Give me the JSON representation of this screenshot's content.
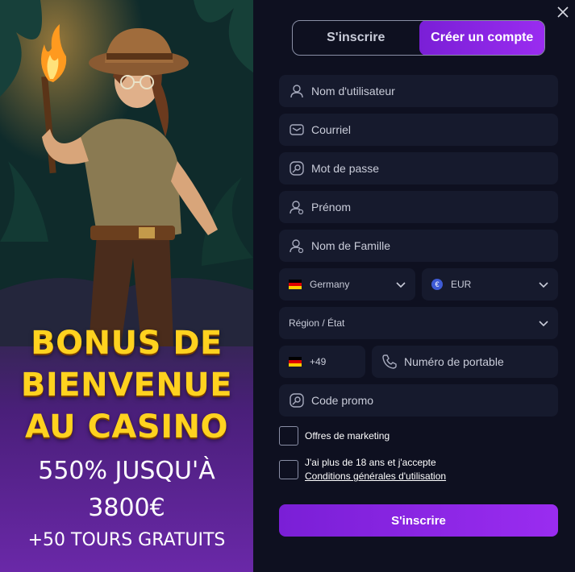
{
  "promo": {
    "title_line1": "BONUS DE",
    "title_line2": "BIENVENUE",
    "title_line3": "AU CASINO",
    "offer_line1": "550% JUSQU'À",
    "offer_line2": "3800€",
    "offer_line3": "+50 TOURS GRATUITS"
  },
  "tabs": {
    "signin_label": "S'inscrire",
    "register_label": "Créer un compte"
  },
  "fields": {
    "username": "Nom d'utilisateur",
    "email": "Courriel",
    "password": "Mot de passe",
    "first_name": "Prénom",
    "last_name": "Nom de Famille",
    "country": "Germany",
    "currency": "EUR",
    "region": "Région / État",
    "phone_code": "+49",
    "phone": "Numéro de portable",
    "promo_code": "Code promo"
  },
  "checkboxes": {
    "marketing": "Offres de marketing",
    "age_terms": "J'ai plus de 18 ans et j'accepte",
    "terms_link": "Conditions générales d'utilisation"
  },
  "submit_label": "S'inscrire",
  "colors": {
    "accent": "#8a24e8",
    "promo_yellow": "#ffd21f",
    "field_bg": "#161a2d",
    "panel_bg": "#0e1020"
  },
  "icons": [
    "close-icon",
    "user-icon",
    "mail-icon",
    "lock-icon",
    "user-icon",
    "user-icon",
    "chevron-down-icon",
    "euro-icon",
    "phone-icon",
    "tag-icon"
  ]
}
